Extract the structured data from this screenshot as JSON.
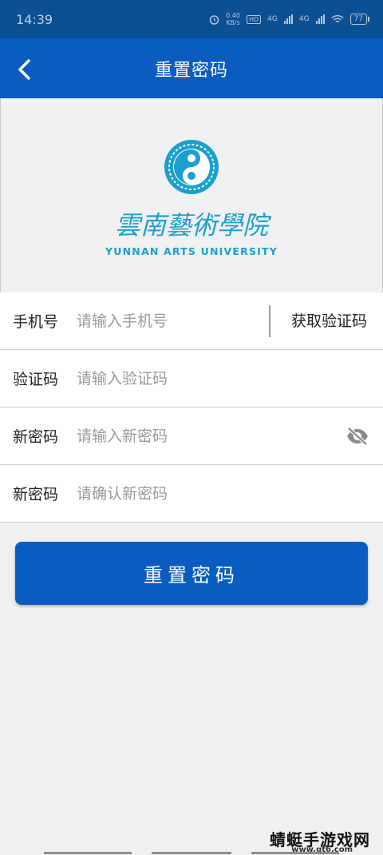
{
  "status_bar": {
    "time": "14:39",
    "net_speed_top": "0.40",
    "net_speed_bottom": "KB/s",
    "hd_label": "HD",
    "signal_1": "4G",
    "signal_2": "4G",
    "battery": "77"
  },
  "header": {
    "title": "重置密码",
    "back_icon": "chevron-left-icon"
  },
  "logo": {
    "calligraphy": "雲南藝術學院",
    "english_name": "YUNNAN ARTS UNIVERSITY",
    "brand_color": "#1aa0cf"
  },
  "form": {
    "phone": {
      "label": "手机号",
      "placeholder": "请输入手机号",
      "get_code_label": "获取验证码"
    },
    "code": {
      "label": "验证码",
      "placeholder": "请输入验证码"
    },
    "new_password": {
      "label": "新密码",
      "placeholder": "请输入新密码",
      "toggle_icon": "eye-slash-icon"
    },
    "confirm_password": {
      "label": "新密码",
      "placeholder": "请确认新密码"
    }
  },
  "submit": {
    "label": "重置密码"
  },
  "watermark": {
    "text": "蜻蜓手游戏网",
    "url": "www.qt6.com"
  },
  "colors": {
    "primary": "#0a5cc1",
    "status_bar": "#0b4f95",
    "background": "#f0f0f0"
  }
}
